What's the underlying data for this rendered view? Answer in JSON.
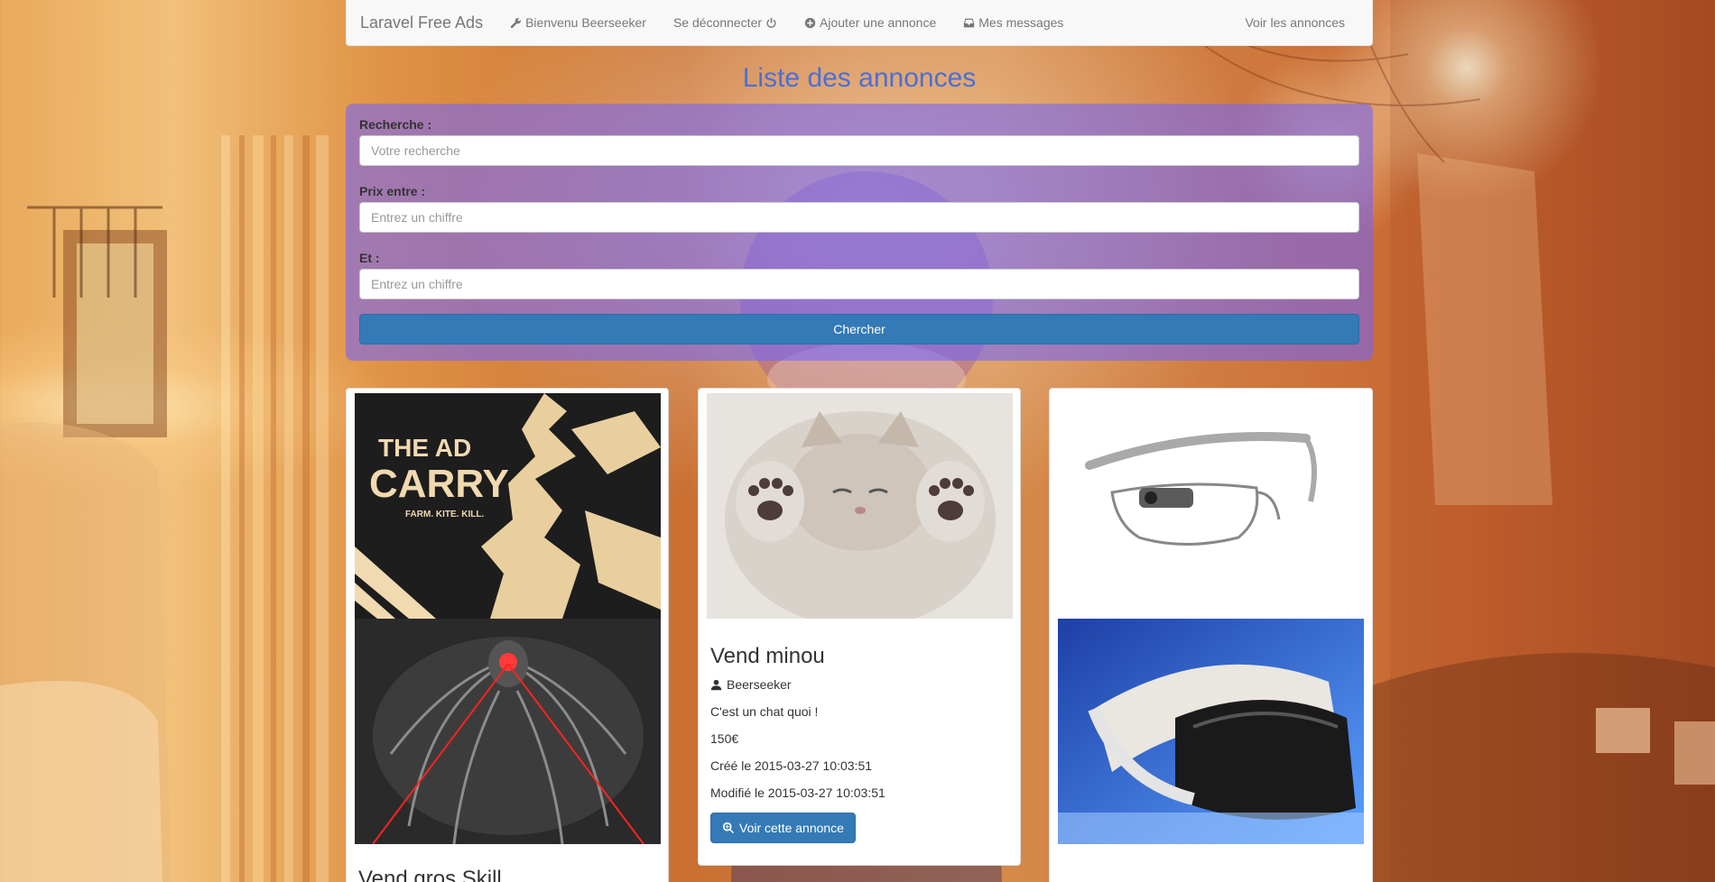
{
  "navbar": {
    "brand": "Laravel Free Ads",
    "links": [
      {
        "label": "Bienvenu Beerseeker",
        "icon": "wrench-icon"
      },
      {
        "label": "Se déconnecter",
        "icon": "power-icon"
      },
      {
        "label": "Ajouter une annonce",
        "icon": "plus-circle-icon"
      },
      {
        "label": "Mes messages",
        "icon": "inbox-icon"
      }
    ],
    "right_link": "Voir les annonces"
  },
  "page": {
    "title": "Liste des annonces"
  },
  "search": {
    "query_label": "Recherche :",
    "query_placeholder": "Votre recherche",
    "query_value": "",
    "price_min_label": "Prix entre :",
    "price_min_placeholder": "Entrez un chiffre",
    "price_min_value": "",
    "price_max_label": "Et :",
    "price_max_placeholder": "Entrez un chiffre",
    "price_max_value": "",
    "submit_label": "Chercher"
  },
  "ads": [
    {
      "title": "Vend gros Skill",
      "images": [
        "ad-carry-poster",
        "robot-spider-artwork"
      ]
    },
    {
      "title": "Vend minou",
      "author": "Beerseeker",
      "description": "C'est un chat quoi !",
      "price": "150€",
      "created": "Créé le 2015-03-27 10:03:51",
      "modified": "Modifié le 2015-03-27 10:03:51",
      "button_label": "Voir cette annonce",
      "images": [
        "kitten-photo"
      ]
    },
    {
      "images": [
        "smart-glasses-photo",
        "vr-headset-photo"
      ]
    }
  ],
  "poster_text": {
    "line1": "THE AD",
    "line2": "CARRY",
    "line3": "FARM. KITE. KILL."
  },
  "colors": {
    "primary": "#337ab7",
    "title": "#4a6fd8",
    "search_panel": "rgba(115,100,250,0.58)"
  }
}
